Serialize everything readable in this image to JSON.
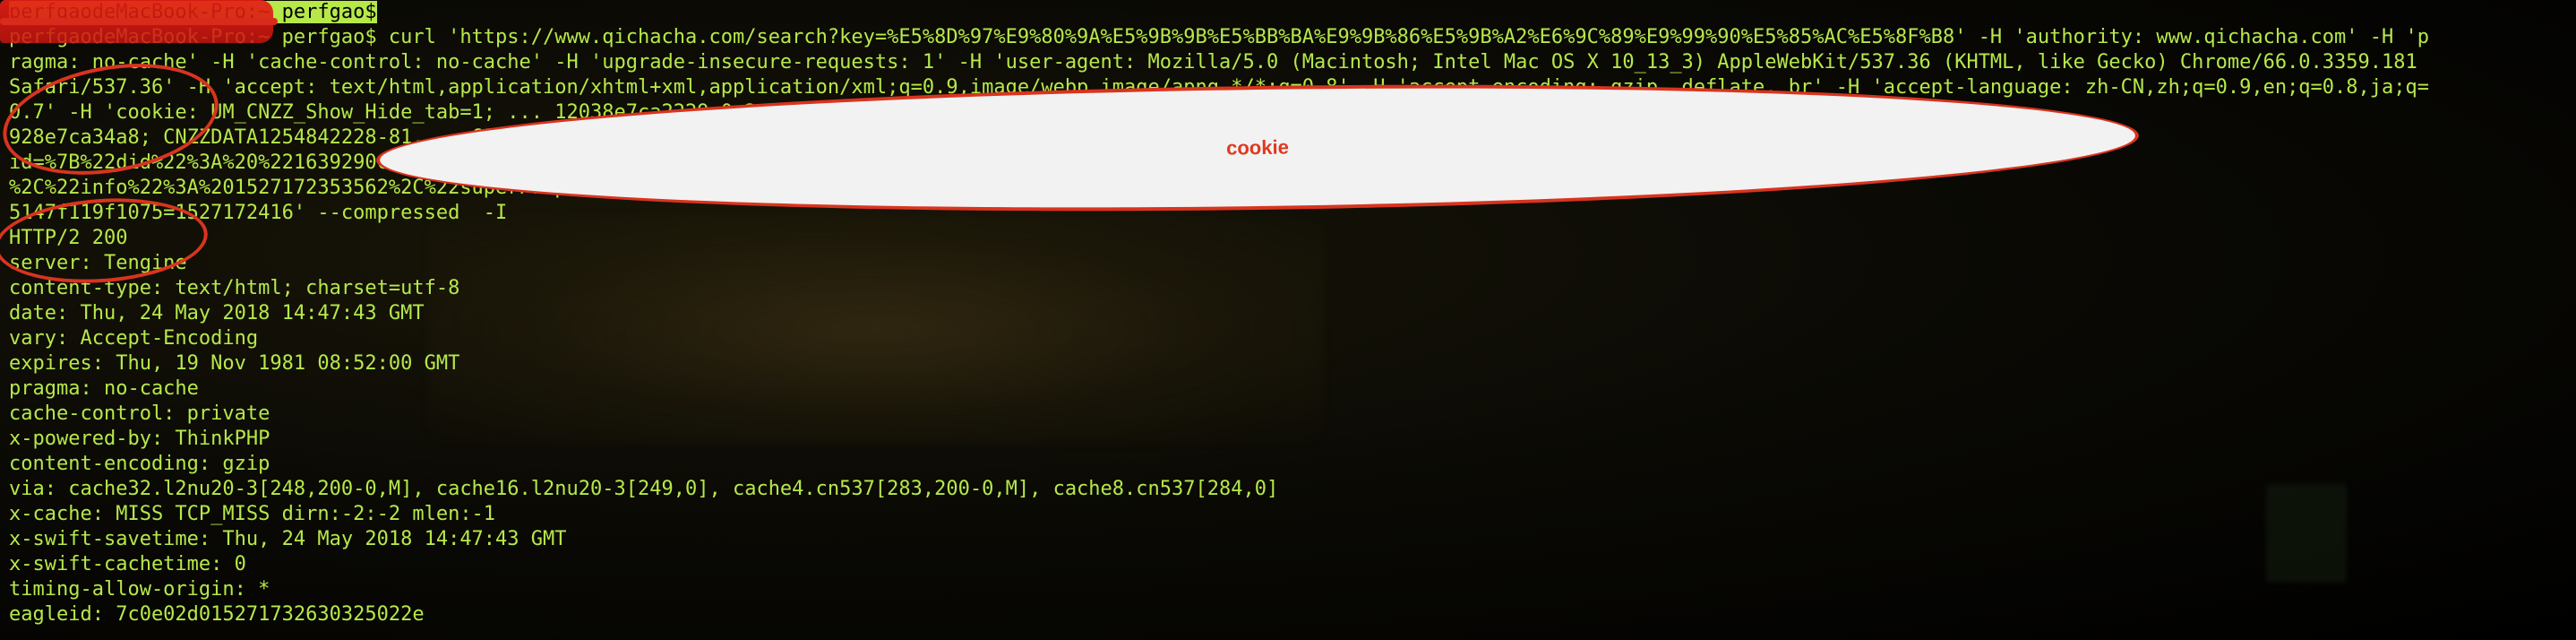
{
  "terminal": {
    "lines": [
      "perfgaodeMacBook-Pro:~ perfgao$",
      "perfgaodeMacBook-Pro:~ perfgao$ curl 'https://www.qichacha.com/search?key=%E5%8D%97%E9%80%9A%E5%9B%9B%E5%BB%BA%E9%9B%86%E5%9B%A2%E6%9C%89%E9%99%90%E5%85%AC%E5%8F%B8' -H 'authority: www.qichacha.com' -H 'p",
      "ragma: no-cache' -H 'cache-control: no-cache' -H 'upgrade-insecure-requests: 1' -H 'user-agent: Mozilla/5.0 (Macintosh; Intel Mac OS X 10_13_3) AppleWebKit/537.36 (KHTML, like Gecko) Chrome/66.0.3359.181",
      "Safari/537.36' -H 'accept: text/html,application/xhtml+xml,application/xml;q=0.9,image/webp,image/apng,*/*;q=0.8' -H 'accept-encoding: gzip, deflate, br' -H 'accept-language: zh-CN,zh;q=0.9,en;q=0.8,ja;q=",
      "0.7' -H 'cookie: UM_CNZZ_Show_Hide_tab=1; ... 12038e7ca2229-0e246fc4ad676b-336b7706-13c680-163",
      "928e7ca34a8; CNZZDATA1254842228-81... c63fb5147f119f1075=1527172230; zg_d",
      "id=%7B%22did%22%3A%20%221639290ce14fe-0aa06d82b58caf-336b77... 6%2C%22updated%22%3A%201527172415661",
      "%2C%22info%22%3A%201527172353562%2C%22superProperty%22%3A%20%22%7B%7D%22%2C%22pl... A%22%3A%20%22%22%7D; Hm_lpvt_3456bee468c83cc63fb",
      "5147f119f1075=1527172416' --compressed  -I",
      "HTTP/2 200",
      "server: Tengine",
      "content-type: text/html; charset=utf-8",
      "date: Thu, 24 May 2018 14:47:43 GMT",
      "vary: Accept-Encoding",
      "expires: Thu, 19 Nov 1981 08:52:00 GMT",
      "pragma: no-cache",
      "cache-control: private",
      "x-powered-by: ThinkPHP",
      "content-encoding: gzip",
      "via: cache32.l2nu20-3[248,200-0,M], cache16.l2nu20-3[249,0], cache4.cn537[283,200-0,M], cache8.cn537[284,0]",
      "x-cache: MISS TCP_MISS dirn:-2:-2 mlen:-1",
      "x-swift-savetime: Thu, 24 May 2018 14:47:43 GMT",
      "x-swift-cachetime: 0",
      "timing-allow-origin: *",
      "eagleid: 7c0e02d015271732630325022e"
    ]
  },
  "annotation": {
    "callout_label": "cookie"
  },
  "colors": {
    "terminal_text": "#b6e84a",
    "annotation_red": "#d9341f",
    "callout_fill": "#f2f2f2",
    "background": "#000000"
  }
}
